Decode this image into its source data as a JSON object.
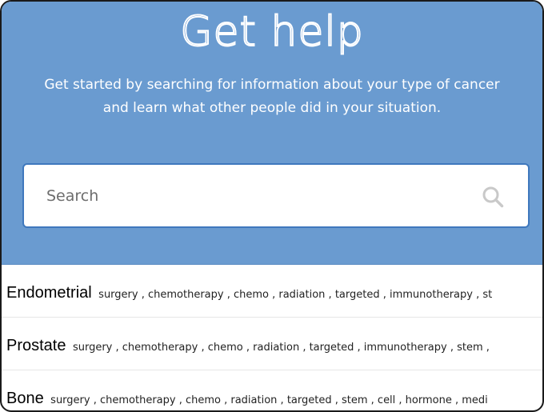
{
  "hero": {
    "title": "Get help",
    "description_line1": "Get started by searching for information about your type of cancer",
    "description_line2": "and learn what other people did in your situation."
  },
  "search": {
    "placeholder": "Search",
    "value": ""
  },
  "results": [
    {
      "name": "Endometrial",
      "tags": "surgery , chemotherapy , chemo , radiation , targeted , immunotherapy , st"
    },
    {
      "name": "Prostate",
      "tags": "surgery , chemotherapy , chemo , radiation , targeted , immunotherapy , stem ,"
    },
    {
      "name": "Bone",
      "tags": "surgery , chemotherapy , chemo , radiation , targeted , stem , cell , hormone , medi"
    }
  ],
  "colors": {
    "hero_background": "#6a9bd0",
    "search_border": "#3f78bd",
    "title_fill": "#4c84c4"
  }
}
